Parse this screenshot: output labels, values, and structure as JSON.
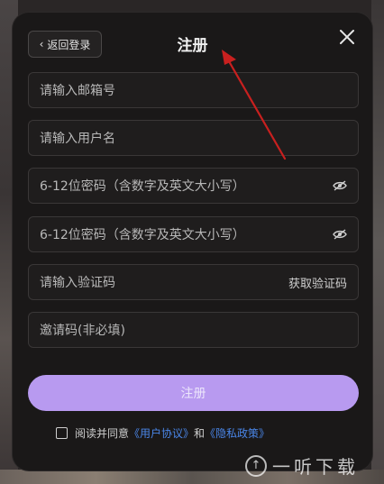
{
  "header": {
    "back_label": "返回登录",
    "title": "注册"
  },
  "form": {
    "email_placeholder": "请输入邮箱号",
    "username_placeholder": "请输入用户名",
    "password_placeholder": "6-12位密码（含数字及英文大小写）",
    "confirm_password_placeholder": "6-12位密码（含数字及英文大小写）",
    "code_placeholder": "请输入验证码",
    "get_code_label": "获取验证码",
    "invite_placeholder": "邀请码(非必填)",
    "submit_label": "注册"
  },
  "agreement": {
    "prefix": "阅读并同意",
    "user_agreement": "《用户协议》",
    "and": "和",
    "privacy_policy": "《隐私政策》"
  },
  "watermark": {
    "text": "一听下载"
  },
  "colors": {
    "accent": "#b89af0",
    "link": "#4a86e8",
    "annotation_arrow": "#c8201f"
  }
}
